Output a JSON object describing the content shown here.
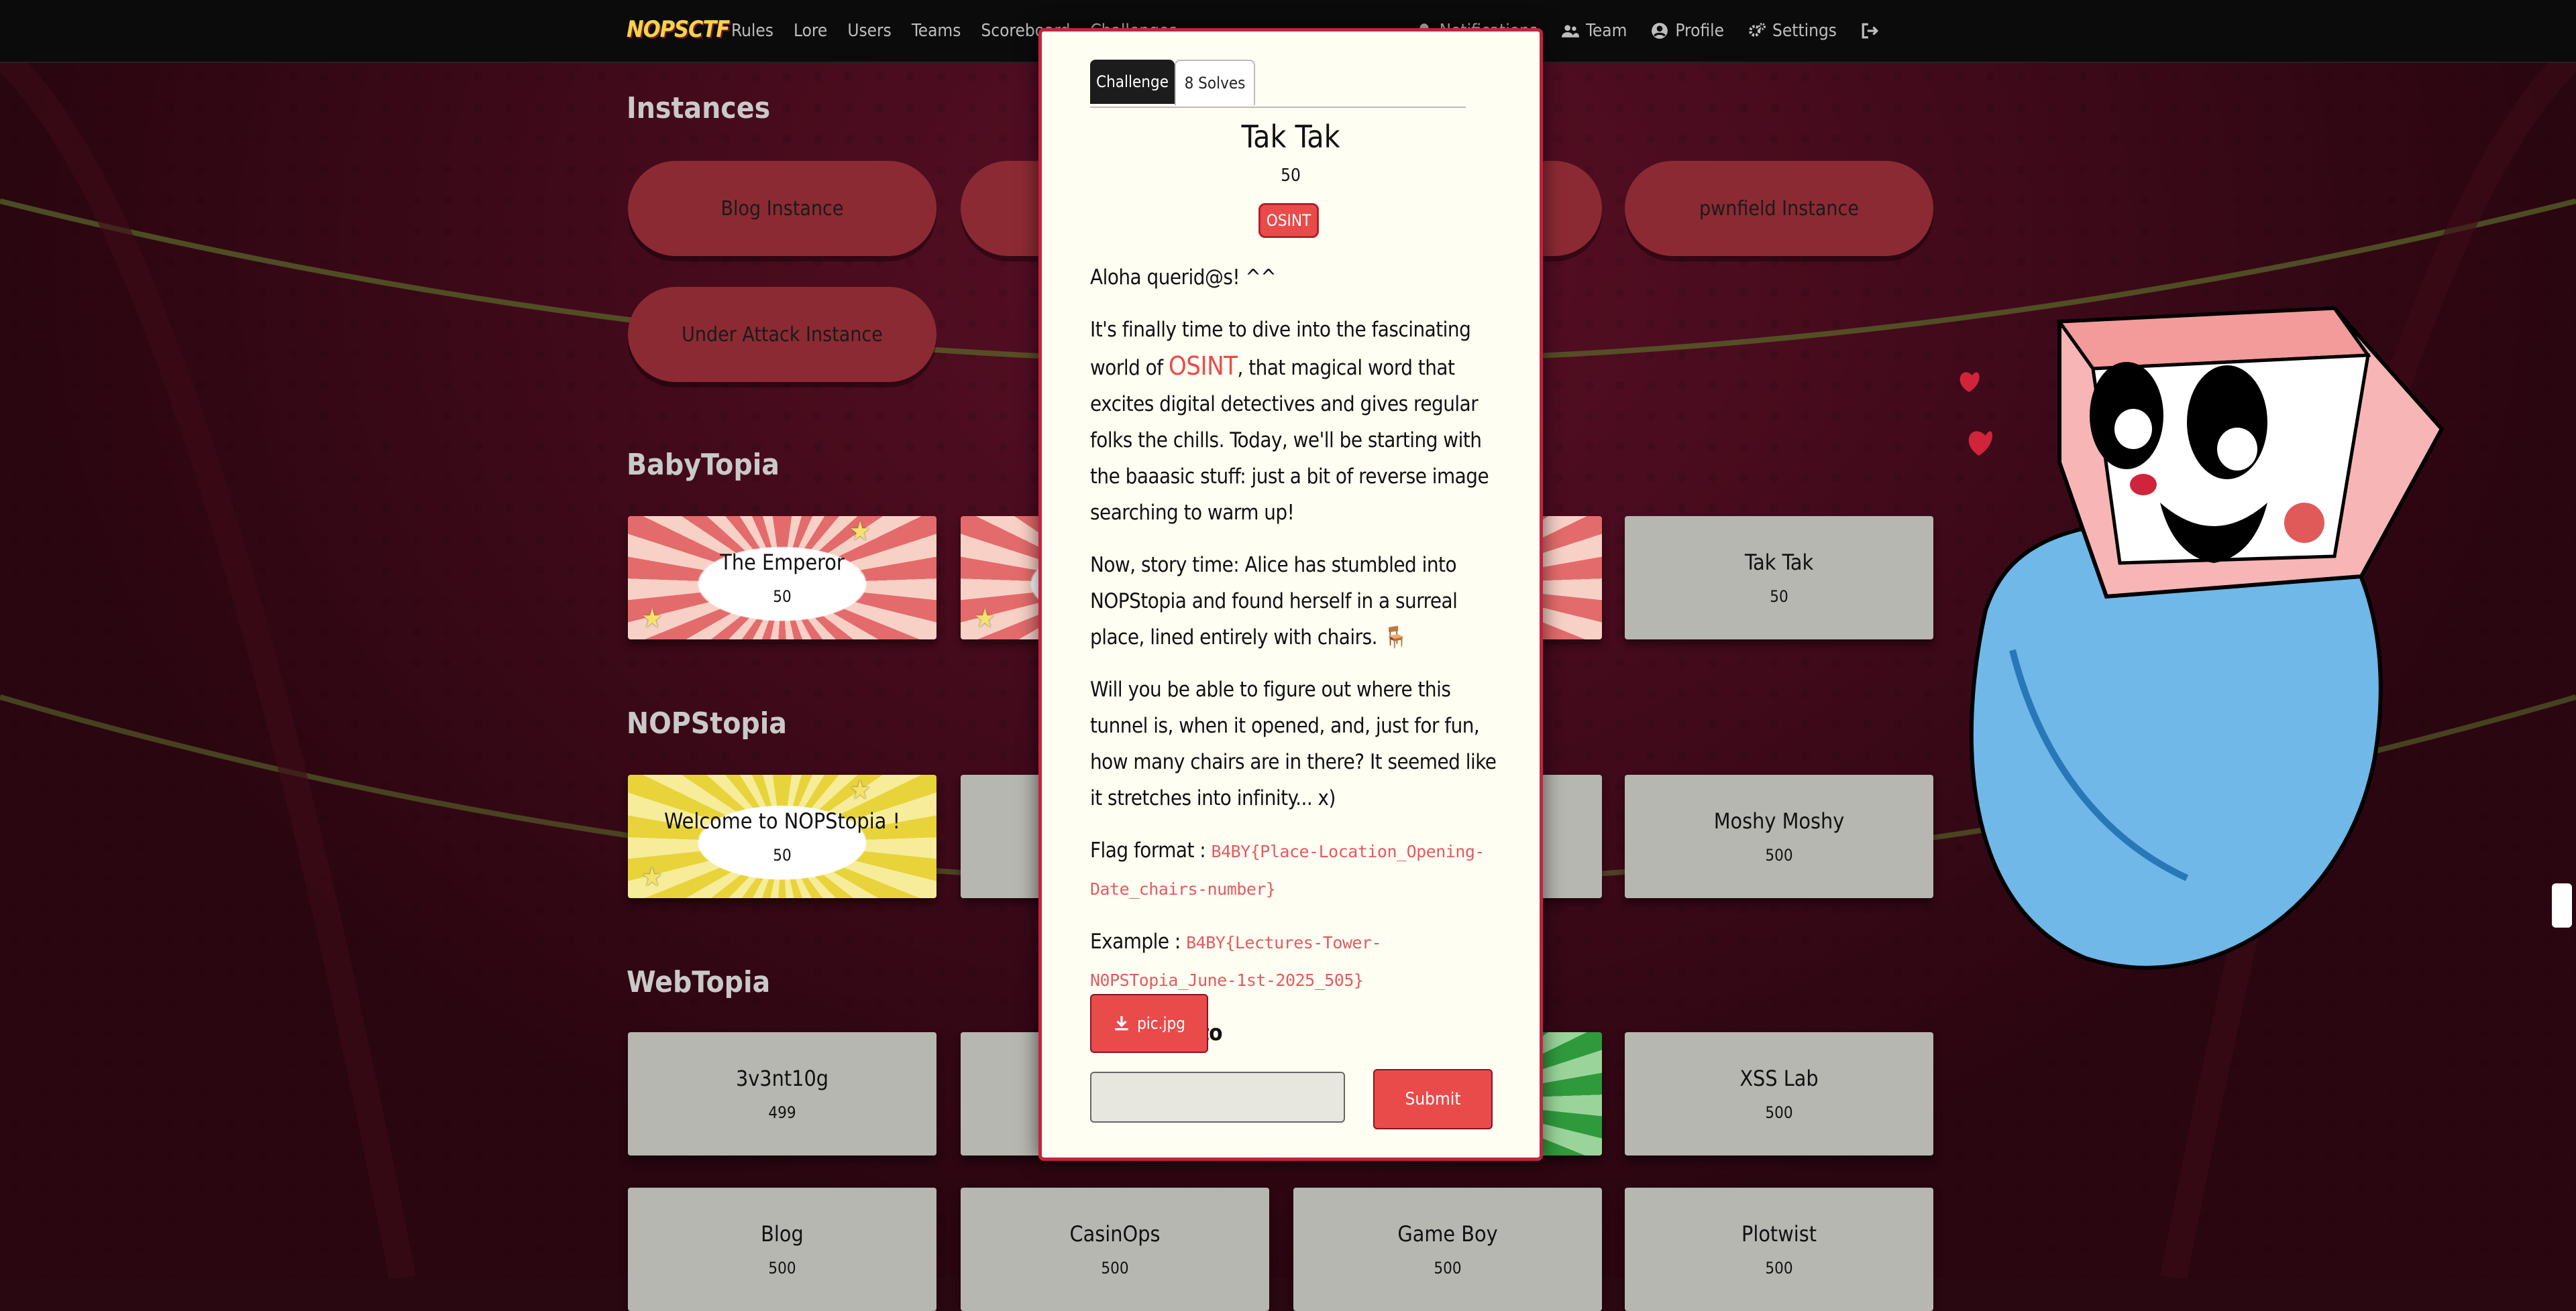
{
  "nav": {
    "logo": "NOPSCTF",
    "left_links": [
      "Rules",
      "Lore",
      "Users",
      "Teams",
      "Scoreboard",
      "Challenges"
    ],
    "right_links": [
      {
        "label": "Notifications",
        "icon": "bell-icon"
      },
      {
        "label": "Team",
        "icon": "users-icon"
      },
      {
        "label": "Profile",
        "icon": "user-circle-icon"
      },
      {
        "label": "Settings",
        "icon": "gears-icon"
      },
      {
        "label": "",
        "icon": "logout-icon"
      }
    ]
  },
  "sections": {
    "instances": {
      "title": "Instances",
      "buttons": [
        "Blog Instance",
        "",
        "",
        "pwnfield Instance",
        "Under Attack Instance"
      ]
    },
    "babytopia": {
      "title": "BabyTopia",
      "cards": [
        {
          "name": "The Emperor",
          "points": "50"
        },
        {
          "name": "",
          "points": ""
        },
        {
          "name": "",
          "points": ""
        },
        {
          "name": "Tak Tak",
          "points": "50"
        }
      ]
    },
    "nopstopia": {
      "title": "NOPStopia",
      "cards": [
        {
          "name": "Welcome to NOPStopia !",
          "points": "50"
        },
        {
          "name": "",
          "points": ""
        },
        {
          "name": "",
          "points": ""
        },
        {
          "name": "Moshy Moshy",
          "points": "500"
        }
      ]
    },
    "webtopia": {
      "title": "WebTopia",
      "cards": [
        {
          "name": "3v3nt10g",
          "points": "499"
        },
        {
          "name": "",
          "points": ""
        },
        {
          "name": "",
          "points": ""
        },
        {
          "name": "XSS Lab",
          "points": "500"
        },
        {
          "name": "Blog",
          "points": "500"
        },
        {
          "name": "CasinOps",
          "points": "500"
        },
        {
          "name": "Game Boy",
          "points": "500"
        },
        {
          "name": "Plotwist",
          "points": "500"
        }
      ]
    }
  },
  "modal": {
    "tabs": [
      "Challenge",
      "8 Solves"
    ],
    "title": "Tak Tak",
    "value": "50",
    "tag": "OSINT",
    "greeting": "Aloha querid@s! ^^",
    "para1_start": "It's finally time to dive into the fascinating world of",
    "para1_highlight": "OSINT",
    "para1_end": ", that magical word that excites digital detectives and gives regular folks the chills. Today, we'll be starting with the baaasic stuff: just a bit of reverse image searching to warm up!",
    "para2": "Now, story time: Alice has stumbled into NOPStopia and found herself in a surreal place, lined entirely with chairs.",
    "para2_emoji": "🪑",
    "para3": "Will you be able to figure out where this tunnel is, when it opened, and, just for fun, how many chairs are in there? It seemed like it stretches into infinity... x)",
    "flag_format_label": "Flag format :",
    "flag_format": "B4BY{Place-Location_Opening-Date_chairs-number}",
    "example_label": "Example :",
    "example": "B4BY{Lectures-Tower-N0PSTopia_June-1st-2025_505}",
    "author": "Author : Sto",
    "file_button": "pic.jpg",
    "answer_placeholder": "",
    "submit": "Submit"
  },
  "colors": {
    "accent": "#e94b4b",
    "modal_border": "#c2243f",
    "modal_bg": "#fffef2",
    "navbar": "#0b0b0b",
    "instance_button": "#8c2a33",
    "card": "#b7b7b1"
  }
}
